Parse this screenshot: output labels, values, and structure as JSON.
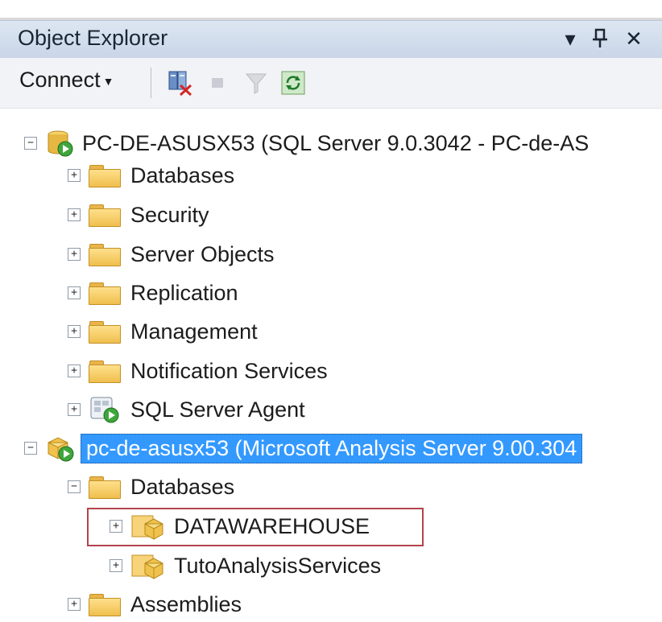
{
  "panel": {
    "title": "Object Explorer",
    "controls": {
      "dropdown": "▾",
      "pin": "ꟸ",
      "close": "✕"
    }
  },
  "toolbar": {
    "connect_label": "Connect",
    "icons": [
      "disconnect-icon",
      "stop-icon",
      "filter-icon",
      "refresh-icon"
    ]
  },
  "tree": {
    "server1": {
      "label": "PC-DE-ASUSX53 (SQL Server 9.0.3042 - PC-de-AS",
      "expander": "−",
      "children": [
        {
          "label": "Databases",
          "expander": "+"
        },
        {
          "label": "Security",
          "expander": "+"
        },
        {
          "label": "Server Objects",
          "expander": "+"
        },
        {
          "label": "Replication",
          "expander": "+"
        },
        {
          "label": "Management",
          "expander": "+"
        },
        {
          "label": "Notification Services",
          "expander": "+"
        },
        {
          "label": "SQL Server Agent",
          "expander": "+"
        }
      ]
    },
    "server2": {
      "label": "pc-de-asusx53 (Microsoft Analysis Server 9.00.304",
      "expander": "−",
      "databases": {
        "label": "Databases",
        "expander": "−",
        "children": [
          {
            "label": "DATAWAREHOUSE",
            "expander": "+"
          },
          {
            "label": "TutoAnalysisServices",
            "expander": "+"
          }
        ]
      },
      "assemblies": {
        "label": "Assemblies",
        "expander": "+"
      }
    }
  },
  "colors": {
    "selection": "#3399ff",
    "focus_box": "#b2444b",
    "titlebar": "#c9d6e8"
  }
}
